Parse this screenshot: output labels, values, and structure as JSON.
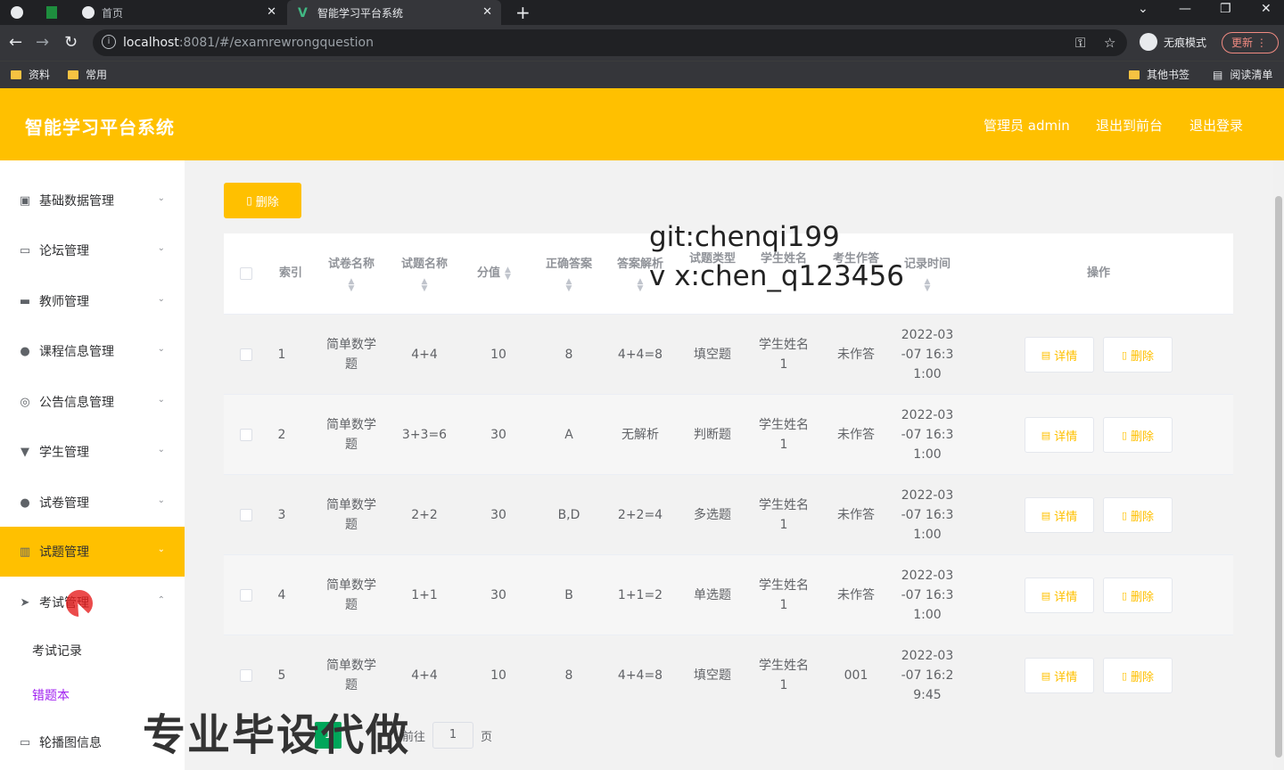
{
  "browser": {
    "tabs": [
      {
        "label": "首页",
        "active": false
      },
      {
        "label": "智能学习平台系统",
        "active": true
      }
    ],
    "url_host": "localhost",
    "url_path": ":8081/#/examrewrongquestion",
    "incognito_label": "无痕模式",
    "update_label": "更新",
    "bookmarks": [
      "资料",
      "常用"
    ],
    "bookmarks_right": [
      "其他书签",
      "阅读清单"
    ]
  },
  "header": {
    "title": "智能学习平台系统",
    "user": "管理员 admin",
    "to_front": "退出到前台",
    "logout": "退出登录"
  },
  "sidebar": {
    "items": [
      {
        "label": "基础数据管理",
        "icon": "clipboard-icon"
      },
      {
        "label": "论坛管理",
        "icon": "chat-icon"
      },
      {
        "label": "教师管理",
        "icon": "briefcase-icon"
      },
      {
        "label": "课程信息管理",
        "icon": "user-icon"
      },
      {
        "label": "公告信息管理",
        "icon": "compass-icon"
      },
      {
        "label": "学生管理",
        "icon": "trophy-icon"
      },
      {
        "label": "试卷管理",
        "icon": "bulb-icon"
      },
      {
        "label": "试题管理",
        "icon": "books-icon"
      },
      {
        "label": "考试管理",
        "icon": "send-icon"
      }
    ],
    "sub_items": [
      "考试记录",
      "错题本"
    ],
    "last_item": "轮播图信息"
  },
  "toolbar": {
    "delete_label": "删除"
  },
  "table": {
    "headers": [
      "索引",
      "试卷名称",
      "试题名称",
      "分值",
      "正确答案",
      "答案解析",
      "试题类型",
      "学生姓名",
      "考生作答",
      "记录时间",
      "操作"
    ],
    "rows": [
      {
        "index": "1",
        "paper": "简单数学题",
        "question": "4+4",
        "score": "10",
        "answer": "8",
        "analysis": "4+4=8",
        "type": "填空题",
        "student": "学生姓名1",
        "response": "未作答",
        "time": "2022-03-07 16:31:00"
      },
      {
        "index": "2",
        "paper": "简单数学题",
        "question": "3+3=6",
        "score": "30",
        "answer": "A",
        "analysis": "无解析",
        "type": "判断题",
        "student": "学生姓名1",
        "response": "未作答",
        "time": "2022-03-07 16:31:00"
      },
      {
        "index": "3",
        "paper": "简单数学题",
        "question": "2+2",
        "score": "30",
        "answer": "B,D",
        "analysis": "2+2=4",
        "type": "多选题",
        "student": "学生姓名1",
        "response": "未作答",
        "time": "2022-03-07 16:31:00"
      },
      {
        "index": "4",
        "paper": "简单数学题",
        "question": "1+1",
        "score": "30",
        "answer": "B",
        "analysis": "1+1=2",
        "type": "单选题",
        "student": "学生姓名1",
        "response": "未作答",
        "time": "2022-03-07 16:31:00"
      },
      {
        "index": "5",
        "paper": "简单数学题",
        "question": "4+4",
        "score": "10",
        "answer": "8",
        "analysis": "4+4=8",
        "type": "填空题",
        "student": "学生姓名1",
        "response": "001",
        "time": "2022-03-07 16:29:45"
      }
    ],
    "detail_label": "详情",
    "delete_label": "删除"
  },
  "pagination": {
    "current": "1",
    "goto_label": "前往",
    "goto_value": "1",
    "page_suffix": "页"
  },
  "watermarks": {
    "line1": "git:chenqi199",
    "line2": "v x:chen_q123456",
    "promo": "专业毕设代做"
  },
  "colors": {
    "brand": "#ffc000",
    "active_sub": "#a020f0"
  }
}
